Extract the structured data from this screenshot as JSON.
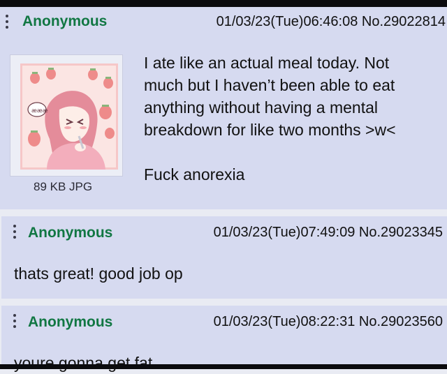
{
  "posts": [
    {
      "name": "Anonymous",
      "datetime": "01/03/23(Tue)06:46:08",
      "post_no": "No.29022814",
      "file_info": "89 KB JPG",
      "body": "I ate like an actual meal today. Not\nmuch but I haven’t been able to eat\nanything without having a mental\nbreakdown for like two months >w<\n\nFuck anorexia",
      "thumbnail": {
        "icon": "anime-girl-eating-thumbnail",
        "bubble_text": "æææ"
      }
    },
    {
      "name": "Anonymous",
      "datetime": "01/03/23(Tue)07:49:09",
      "post_no": "No.29023345",
      "body": "thats great! good job op"
    },
    {
      "name": "Anonymous",
      "datetime": "01/03/23(Tue)08:22:31",
      "post_no": "No.29023560",
      "body": "youre gonna get fat"
    }
  ],
  "colors": {
    "background": "#e9ebf3",
    "post_bg": "#d6daf0",
    "name_green": "#117743",
    "frame": "#0b0b0e"
  },
  "icons": {
    "post_menu": "vertical-dots-menu-icon"
  }
}
